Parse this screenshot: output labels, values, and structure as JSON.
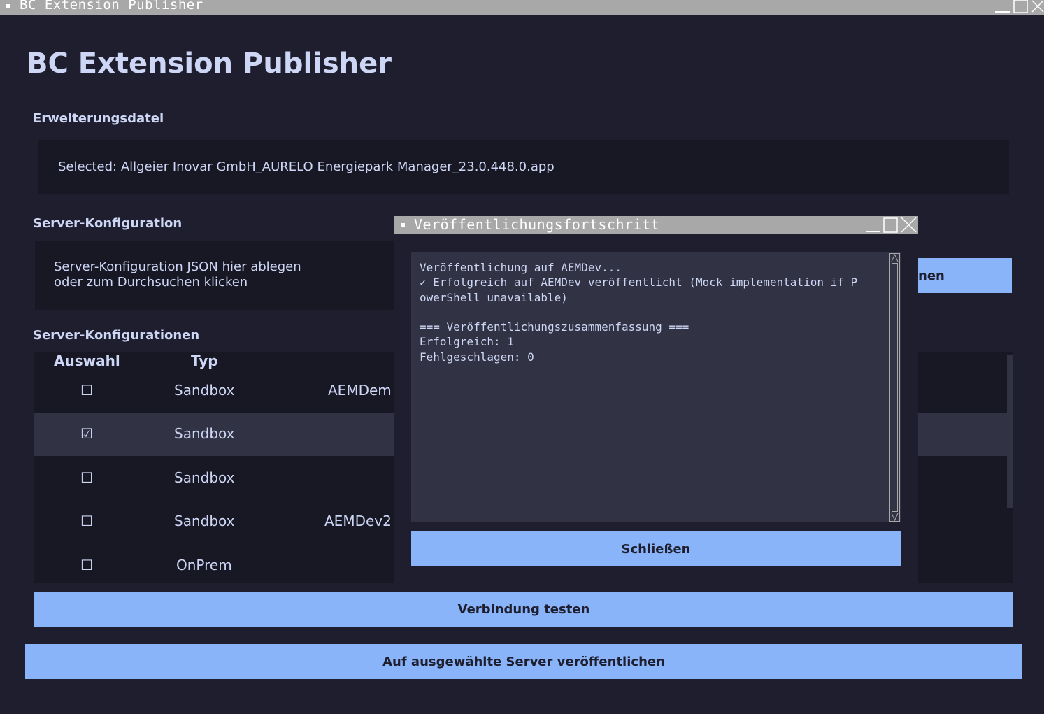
{
  "window": {
    "title": "BC Extension Publisher"
  },
  "app": {
    "title": "BC Extension Publisher"
  },
  "extension_file": {
    "label": "Erweiterungsdatei",
    "selected_text": "Selected: Allgeier Inovar GmbH_AURELO Energiepark Manager_23.0.448.0.app"
  },
  "server_config": {
    "label": "Server-Konfiguration",
    "drop_line1": "Server-Konfiguration JSON hier ablegen",
    "drop_line2": "oder zum Durchsuchen klicken",
    "partial_button_label": "nen"
  },
  "server_configs": {
    "label": "Server-Konfigurationen",
    "columns": [
      "Auswahl",
      "Typ"
    ],
    "rows": [
      {
        "checked": false,
        "checkbox": "☐",
        "type": "Sandbox",
        "name": "AEMDem"
      },
      {
        "checked": true,
        "checkbox": "☑",
        "type": "Sandbox",
        "name": ""
      },
      {
        "checked": false,
        "checkbox": "☐",
        "type": "Sandbox",
        "name": ""
      },
      {
        "checked": false,
        "checkbox": "☐",
        "type": "Sandbox",
        "name": "AEMDev2"
      },
      {
        "checked": false,
        "checkbox": "☐",
        "type": "OnPrem",
        "name": ""
      }
    ]
  },
  "buttons": {
    "test_connection": "Verbindung testen",
    "publish": "Auf ausgewählte Server veröffentlichen"
  },
  "dialog": {
    "title": "Veröffentlichungsfortschritt",
    "log": "Veröffentlichung auf AEMDev...\n✓ Erfolgreich auf AEMDev veröffentlicht (Mock implementation if P\nowerShell unavailable)\n\n=== Veröffentlichungszusammenfassung ===\nErfolgreich: 1\nFehlgeschlagen: 0",
    "close_button": "Schließen"
  },
  "colors": {
    "background": "#1e1e2e",
    "surface": "#181825",
    "selected_row": "#313244",
    "accent": "#89b4fa",
    "titlebar": "#a8a8a8"
  }
}
